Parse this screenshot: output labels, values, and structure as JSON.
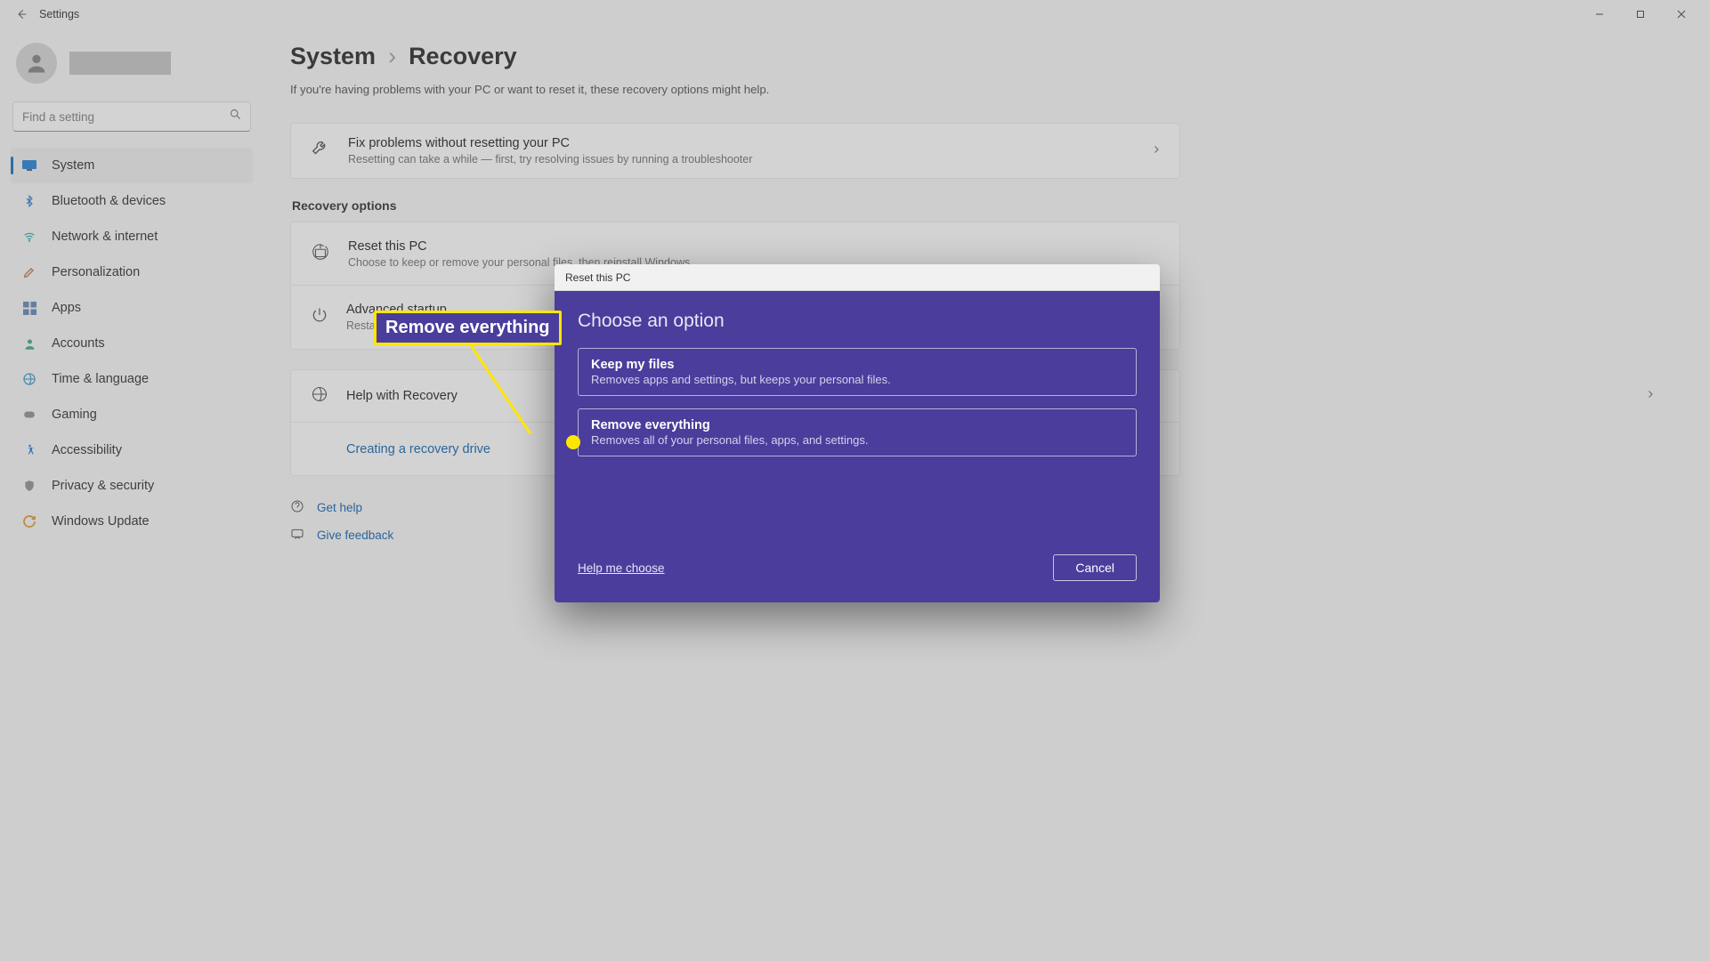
{
  "titlebar": {
    "title": "Settings"
  },
  "search": {
    "placeholder": "Find a setting"
  },
  "sidebar": {
    "items": [
      {
        "label": "System"
      },
      {
        "label": "Bluetooth & devices"
      },
      {
        "label": "Network & internet"
      },
      {
        "label": "Personalization"
      },
      {
        "label": "Apps"
      },
      {
        "label": "Accounts"
      },
      {
        "label": "Time & language"
      },
      {
        "label": "Gaming"
      },
      {
        "label": "Accessibility"
      },
      {
        "label": "Privacy & security"
      },
      {
        "label": "Windows Update"
      }
    ]
  },
  "breadcrumb": {
    "root": "System",
    "sep": "›",
    "current": "Recovery"
  },
  "page": {
    "subtitle": "If you're having problems with your PC or want to reset it, these recovery options might help.",
    "fix": {
      "title": "Fix problems without resetting your PC",
      "desc": "Resetting can take a while — first, try resolving issues by running a troubleshooter"
    },
    "section_label": "Recovery options",
    "reset": {
      "title": "Reset this PC",
      "desc": "Choose to keep or remove your personal files, then reinstall Windows"
    },
    "advanced": {
      "title": "Advanced startup",
      "desc": "Restart your device to change startup settings, including starting from a disc or USB drive"
    },
    "help_recovery": "Help with Recovery",
    "create_drive": "Creating a recovery drive",
    "get_help": "Get help",
    "give_feedback": "Give feedback"
  },
  "modal": {
    "header": "Reset this PC",
    "title": "Choose an option",
    "keep": {
      "title": "Keep my files",
      "desc": "Removes apps and settings, but keeps your personal files."
    },
    "remove": {
      "title": "Remove everything",
      "desc": "Removes all of your personal files, apps, and settings."
    },
    "help_choose": "Help me choose",
    "cancel": "Cancel"
  },
  "callout": {
    "label": "Remove everything"
  }
}
